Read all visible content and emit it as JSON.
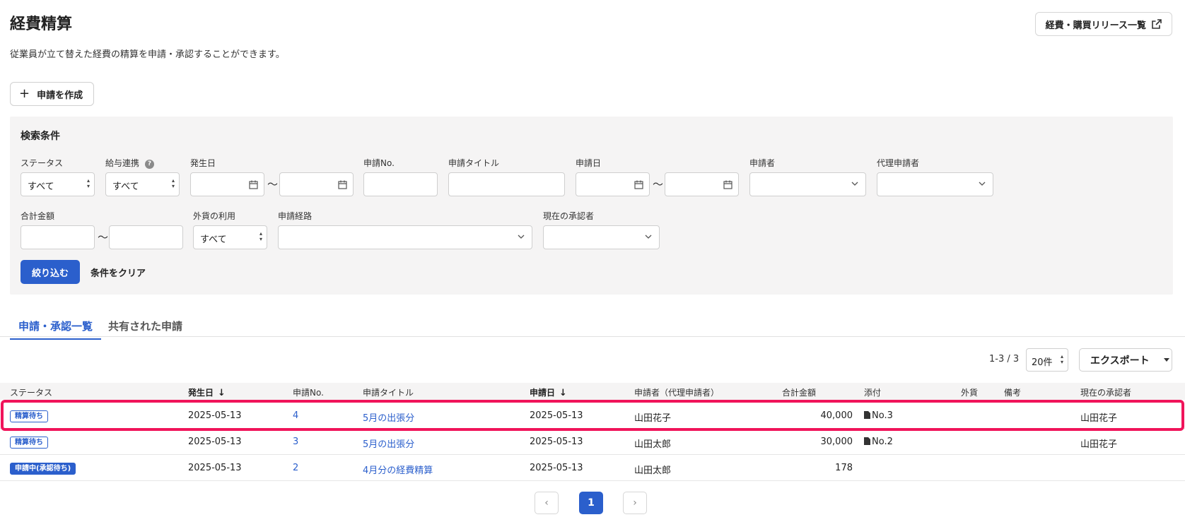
{
  "header": {
    "title": "経費精算",
    "description": "従業員が立て替えた経費の精算を申請・承認することができます。",
    "release_button": "経費・購買リリース一覧",
    "create_button": "申請を作成"
  },
  "search": {
    "title": "検索条件",
    "labels": {
      "status": "ステータス",
      "payroll": "給与連携",
      "occurrence_date": "発生日",
      "application_no": "申請No.",
      "application_title": "申請タイトル",
      "application_date": "申請日",
      "applicant": "申請者",
      "proxy_applicant": "代理申請者",
      "total_amount": "合計金額",
      "foreign_currency": "外貨の利用",
      "approval_route": "申請経路",
      "current_approver": "現在の承認者"
    },
    "values": {
      "status": "すべて",
      "payroll": "すべて",
      "foreign_currency": "すべて"
    },
    "help_glyph": "?",
    "tilde": "〜",
    "filter_button": "絞り込む",
    "clear_button": "条件をクリア"
  },
  "tabs": [
    "申請・承認一覧",
    "共有された申請"
  ],
  "toolbar": {
    "count": "1-3 / 3",
    "per_page": "20件",
    "export_button": "エクスポート"
  },
  "table": {
    "headers": {
      "status": "ステータス",
      "occurrence_date": "発生日",
      "application_no": "申請No.",
      "application_title": "申請タイトル",
      "application_date": "申請日",
      "applicant": "申請者（代理申請者）",
      "total_amount": "合計金額",
      "attachment": "添付",
      "foreign": "外貨",
      "remarks": "備考",
      "current_approver": "現在の承認者"
    },
    "sort_arrow": "↓",
    "rows": [
      {
        "status": "精算待ち",
        "occurrence_date": "2025-05-13",
        "no": "4",
        "title": "5月の出張分",
        "application_date": "2025-05-13",
        "applicant": "山田花子",
        "amount": "40,000",
        "attachment": "No.3",
        "approver": "山田花子"
      },
      {
        "status": "精算待ち",
        "occurrence_date": "2025-05-13",
        "no": "3",
        "title": "5月の出張分",
        "application_date": "2025-05-13",
        "applicant": "山田太郎",
        "amount": "30,000",
        "attachment": "No.2",
        "approver": "山田花子"
      },
      {
        "status": "申請中(承認待ち)",
        "occurrence_date": "2025-05-13",
        "no": "2",
        "title": "4月分の経費精算",
        "application_date": "2025-05-13",
        "applicant": "山田太郎",
        "amount": "178",
        "attachment": "",
        "approver": ""
      }
    ]
  },
  "pagination": {
    "prev": "‹",
    "current": "1",
    "next": "›"
  },
  "colors": {
    "accent": "#2b5fcc",
    "highlight": "#f0145a",
    "panel": "#f5f4f4"
  }
}
